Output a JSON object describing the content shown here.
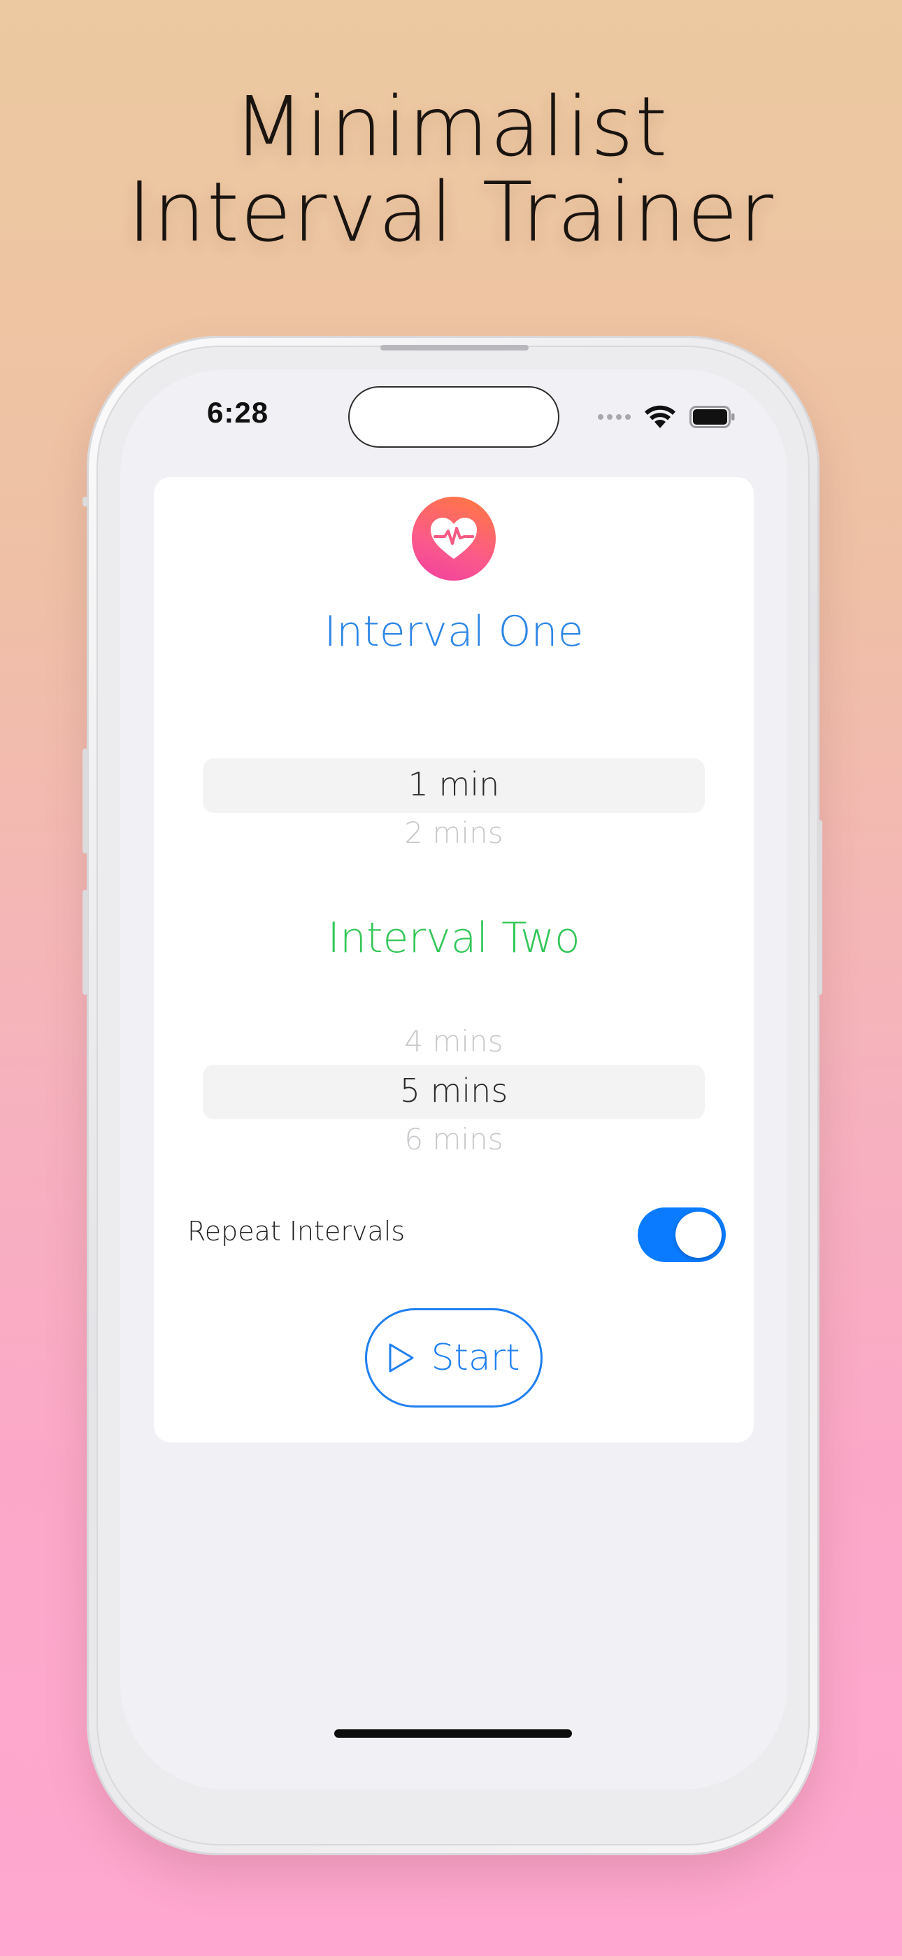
{
  "headline": {
    "line1": "Minimalist",
    "line2": "Interval Trainer"
  },
  "status_bar": {
    "time": "6:28",
    "icons": [
      "cellular-dots-icon",
      "wifi-icon",
      "battery-icon"
    ]
  },
  "app": {
    "icon": "heart-pulse-icon",
    "interval_one": {
      "title": "Interval One",
      "title_color": "#2e86e6",
      "selected": "1 min",
      "next": "2 mins"
    },
    "interval_two": {
      "title": "Interval Two",
      "title_color": "#34c759",
      "previous": "4 mins",
      "selected": "5 mins",
      "next": "6 mins"
    },
    "repeat": {
      "label": "Repeat Intervals",
      "enabled": true
    },
    "start_button": {
      "label": "Start",
      "icon": "play-icon",
      "color": "#1f7ff0"
    }
  }
}
